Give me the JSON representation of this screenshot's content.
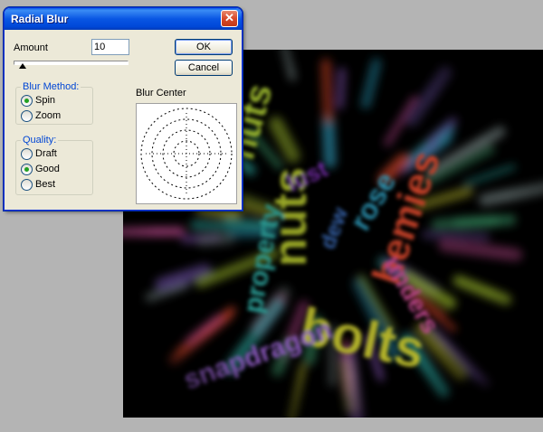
{
  "dialog": {
    "title": "Radial Blur",
    "close_glyph": "✕",
    "amount_label": "Amount",
    "amount_value": "10",
    "ok_label": "OK",
    "cancel_label": "Cancel",
    "blur_method": {
      "title": "Blur Method:",
      "options": [
        {
          "label": "Spin",
          "checked": true
        },
        {
          "label": "Zoom",
          "checked": false
        }
      ]
    },
    "quality": {
      "title": "Quality:",
      "options": [
        {
          "label": "Draft",
          "checked": false
        },
        {
          "label": "Good",
          "checked": true
        },
        {
          "label": "Best",
          "checked": false
        }
      ]
    },
    "blur_center_label": "Blur Center"
  },
  "canvas": {
    "words": [
      {
        "text": "bolts",
        "color": "#b6b62a"
      },
      {
        "text": "hemies",
        "color": "#d2452a"
      },
      {
        "text": "nuts",
        "color": "#a8b82b"
      },
      {
        "text": "nuts",
        "color": "#9bb82d"
      },
      {
        "text": "lust",
        "color": "#7a2fb0"
      },
      {
        "text": "property",
        "color": "#2da8a0"
      },
      {
        "text": "snapdragon",
        "color": "#8d5ac0"
      },
      {
        "text": "unders",
        "color": "#c24a92"
      },
      {
        "text": "rose",
        "color": "#2f9fc0"
      },
      {
        "text": "dew",
        "color": "#3c6fc0"
      }
    ]
  }
}
